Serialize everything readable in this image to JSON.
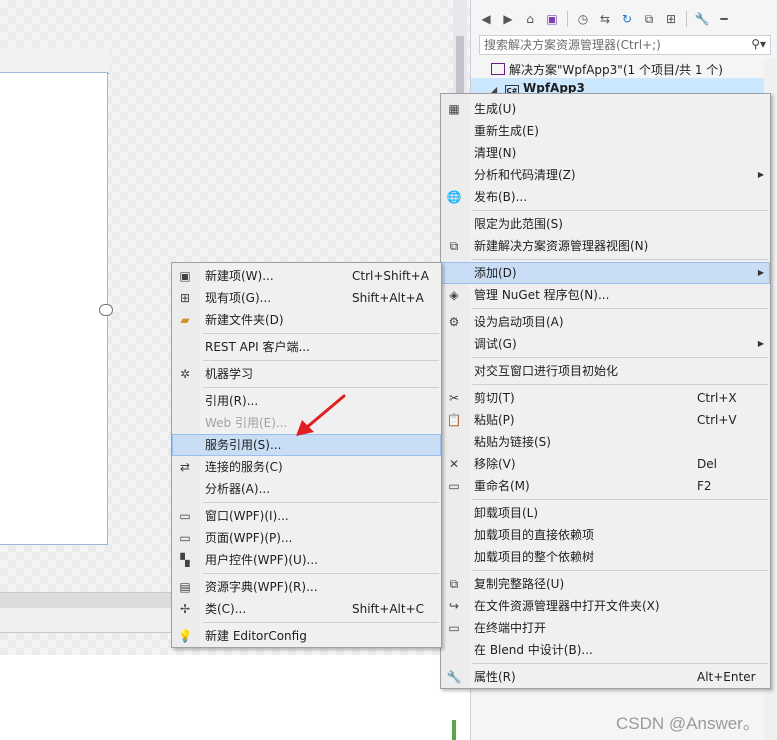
{
  "solution_explorer": {
    "search_placeholder": "搜索解决方案资源管理器(Ctrl+;)",
    "solution_label": "解决方案\"WpfApp3\"(1 个项目/共 1 个)",
    "project_label": "WpfApp3",
    "cs_badge": "C#"
  },
  "main_menu": {
    "items": [
      {
        "label": "生成(U)"
      },
      {
        "label": "重新生成(E)"
      },
      {
        "label": "清理(N)"
      },
      {
        "label": "分析和代码清理(Z)"
      },
      {
        "label": "发布(B)..."
      },
      {
        "label": "限定为此范围(S)"
      },
      {
        "label": "新建解决方案资源管理器视图(N)"
      },
      {
        "label": "添加(D)"
      },
      {
        "label": "管理 NuGet 程序包(N)..."
      },
      {
        "label": "设为启动项目(A)"
      },
      {
        "label": "调试(G)"
      },
      {
        "label": "对交互窗口进行项目初始化"
      },
      {
        "label": "剪切(T)",
        "shortcut": "Ctrl+X"
      },
      {
        "label": "粘贴(P)",
        "shortcut": "Ctrl+V"
      },
      {
        "label": "粘贴为链接(S)"
      },
      {
        "label": "移除(V)",
        "shortcut": "Del"
      },
      {
        "label": "重命名(M)",
        "shortcut": "F2"
      },
      {
        "label": "卸载项目(L)"
      },
      {
        "label": "加载项目的直接依赖项"
      },
      {
        "label": "加载项目的整个依赖树"
      },
      {
        "label": "复制完整路径(U)"
      },
      {
        "label": "在文件资源管理器中打开文件夹(X)"
      },
      {
        "label": "在终端中打开"
      },
      {
        "label": "在 Blend 中设计(B)..."
      },
      {
        "label": "属性(R)",
        "shortcut": "Alt+Enter"
      }
    ]
  },
  "add_menu": {
    "items": [
      {
        "label": "新建项(W)...",
        "shortcut": "Ctrl+Shift+A"
      },
      {
        "label": "现有项(G)...",
        "shortcut": "Shift+Alt+A"
      },
      {
        "label": "新建文件夹(D)"
      },
      {
        "label": "REST API 客户端..."
      },
      {
        "label": "机器学习"
      },
      {
        "label": "引用(R)..."
      },
      {
        "label": "Web 引用(E)..."
      },
      {
        "label": "服务引用(S)..."
      },
      {
        "label": "连接的服务(C)"
      },
      {
        "label": "分析器(A)..."
      },
      {
        "label": "窗口(WPF)(I)..."
      },
      {
        "label": "页面(WPF)(P)..."
      },
      {
        "label": "用户控件(WPF)(U)..."
      },
      {
        "label": "资源字典(WPF)(R)..."
      },
      {
        "label": "类(C)...",
        "shortcut": "Shift+Alt+C"
      },
      {
        "label": "新建 EditorConfig"
      }
    ]
  },
  "watermark": "CSDN @Answer。",
  "colors": {
    "highlight": "#c9def5",
    "annotation_arrow": "#e02020"
  }
}
